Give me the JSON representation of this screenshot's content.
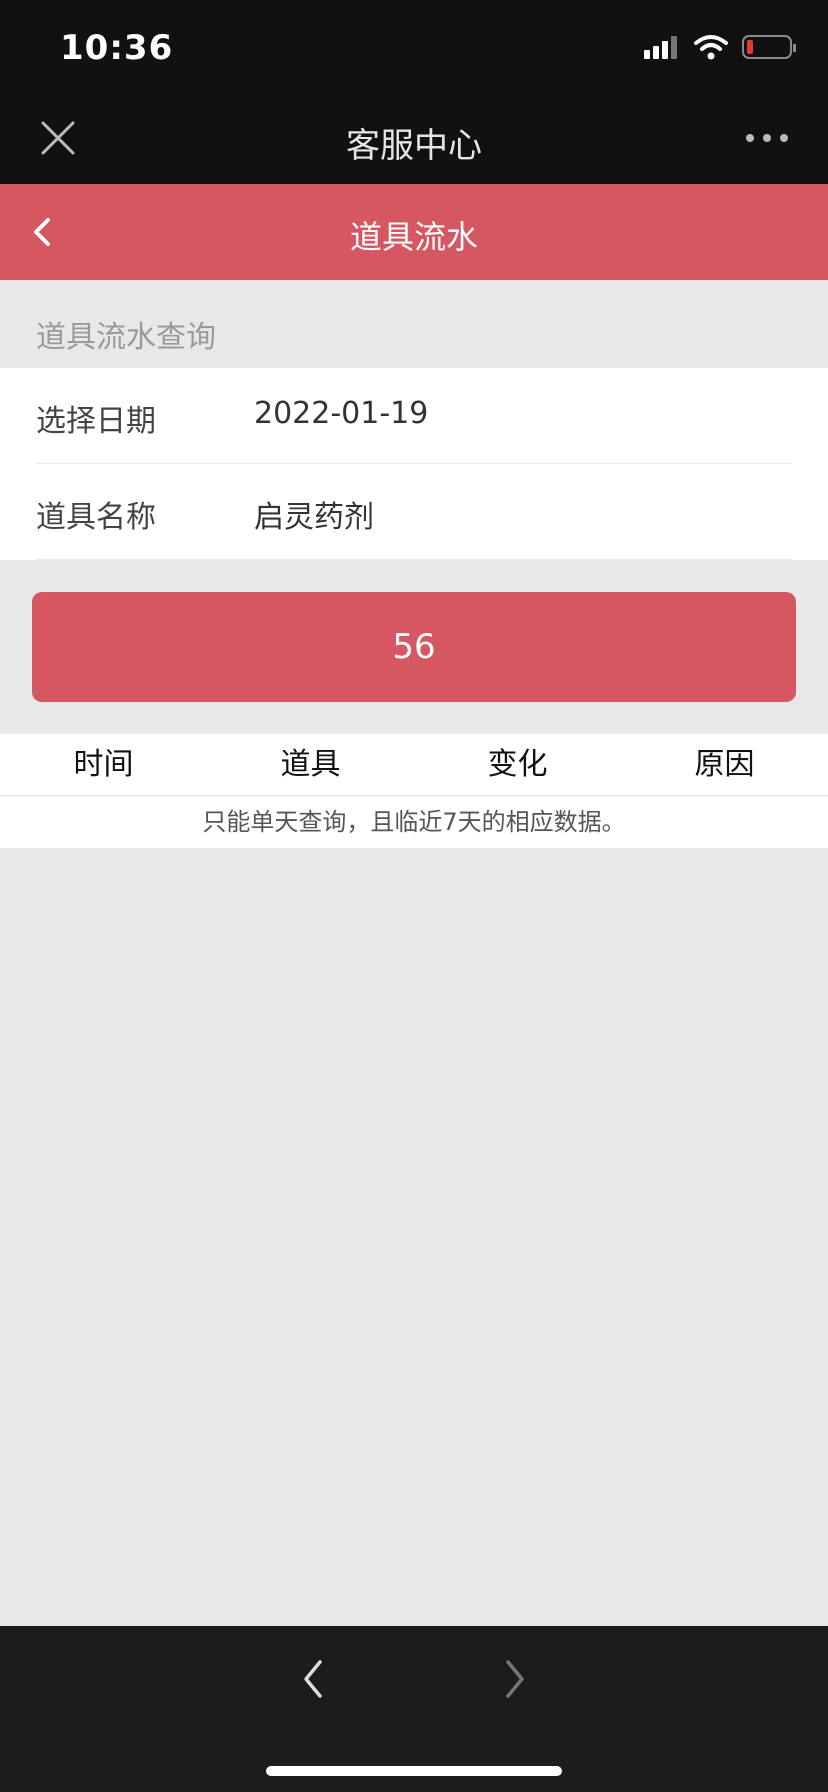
{
  "status_bar": {
    "time": "10:36"
  },
  "wechat_bar": {
    "title": "客服中心"
  },
  "page_header": {
    "title": "道具流水"
  },
  "query": {
    "section_label": "道具流水查询",
    "date_label": "选择日期",
    "date_value": "2022-01-19",
    "item_label": "道具名称",
    "item_value": "启灵药剂",
    "button_label": "56"
  },
  "table": {
    "columns": [
      "时间",
      "道具",
      "变化",
      "原因"
    ],
    "note": "只能单天查询，且临近7天的相应数据。"
  },
  "colors": {
    "accent": "#d45762",
    "dark_bar": "#111111",
    "background": "#e8e8e8"
  }
}
